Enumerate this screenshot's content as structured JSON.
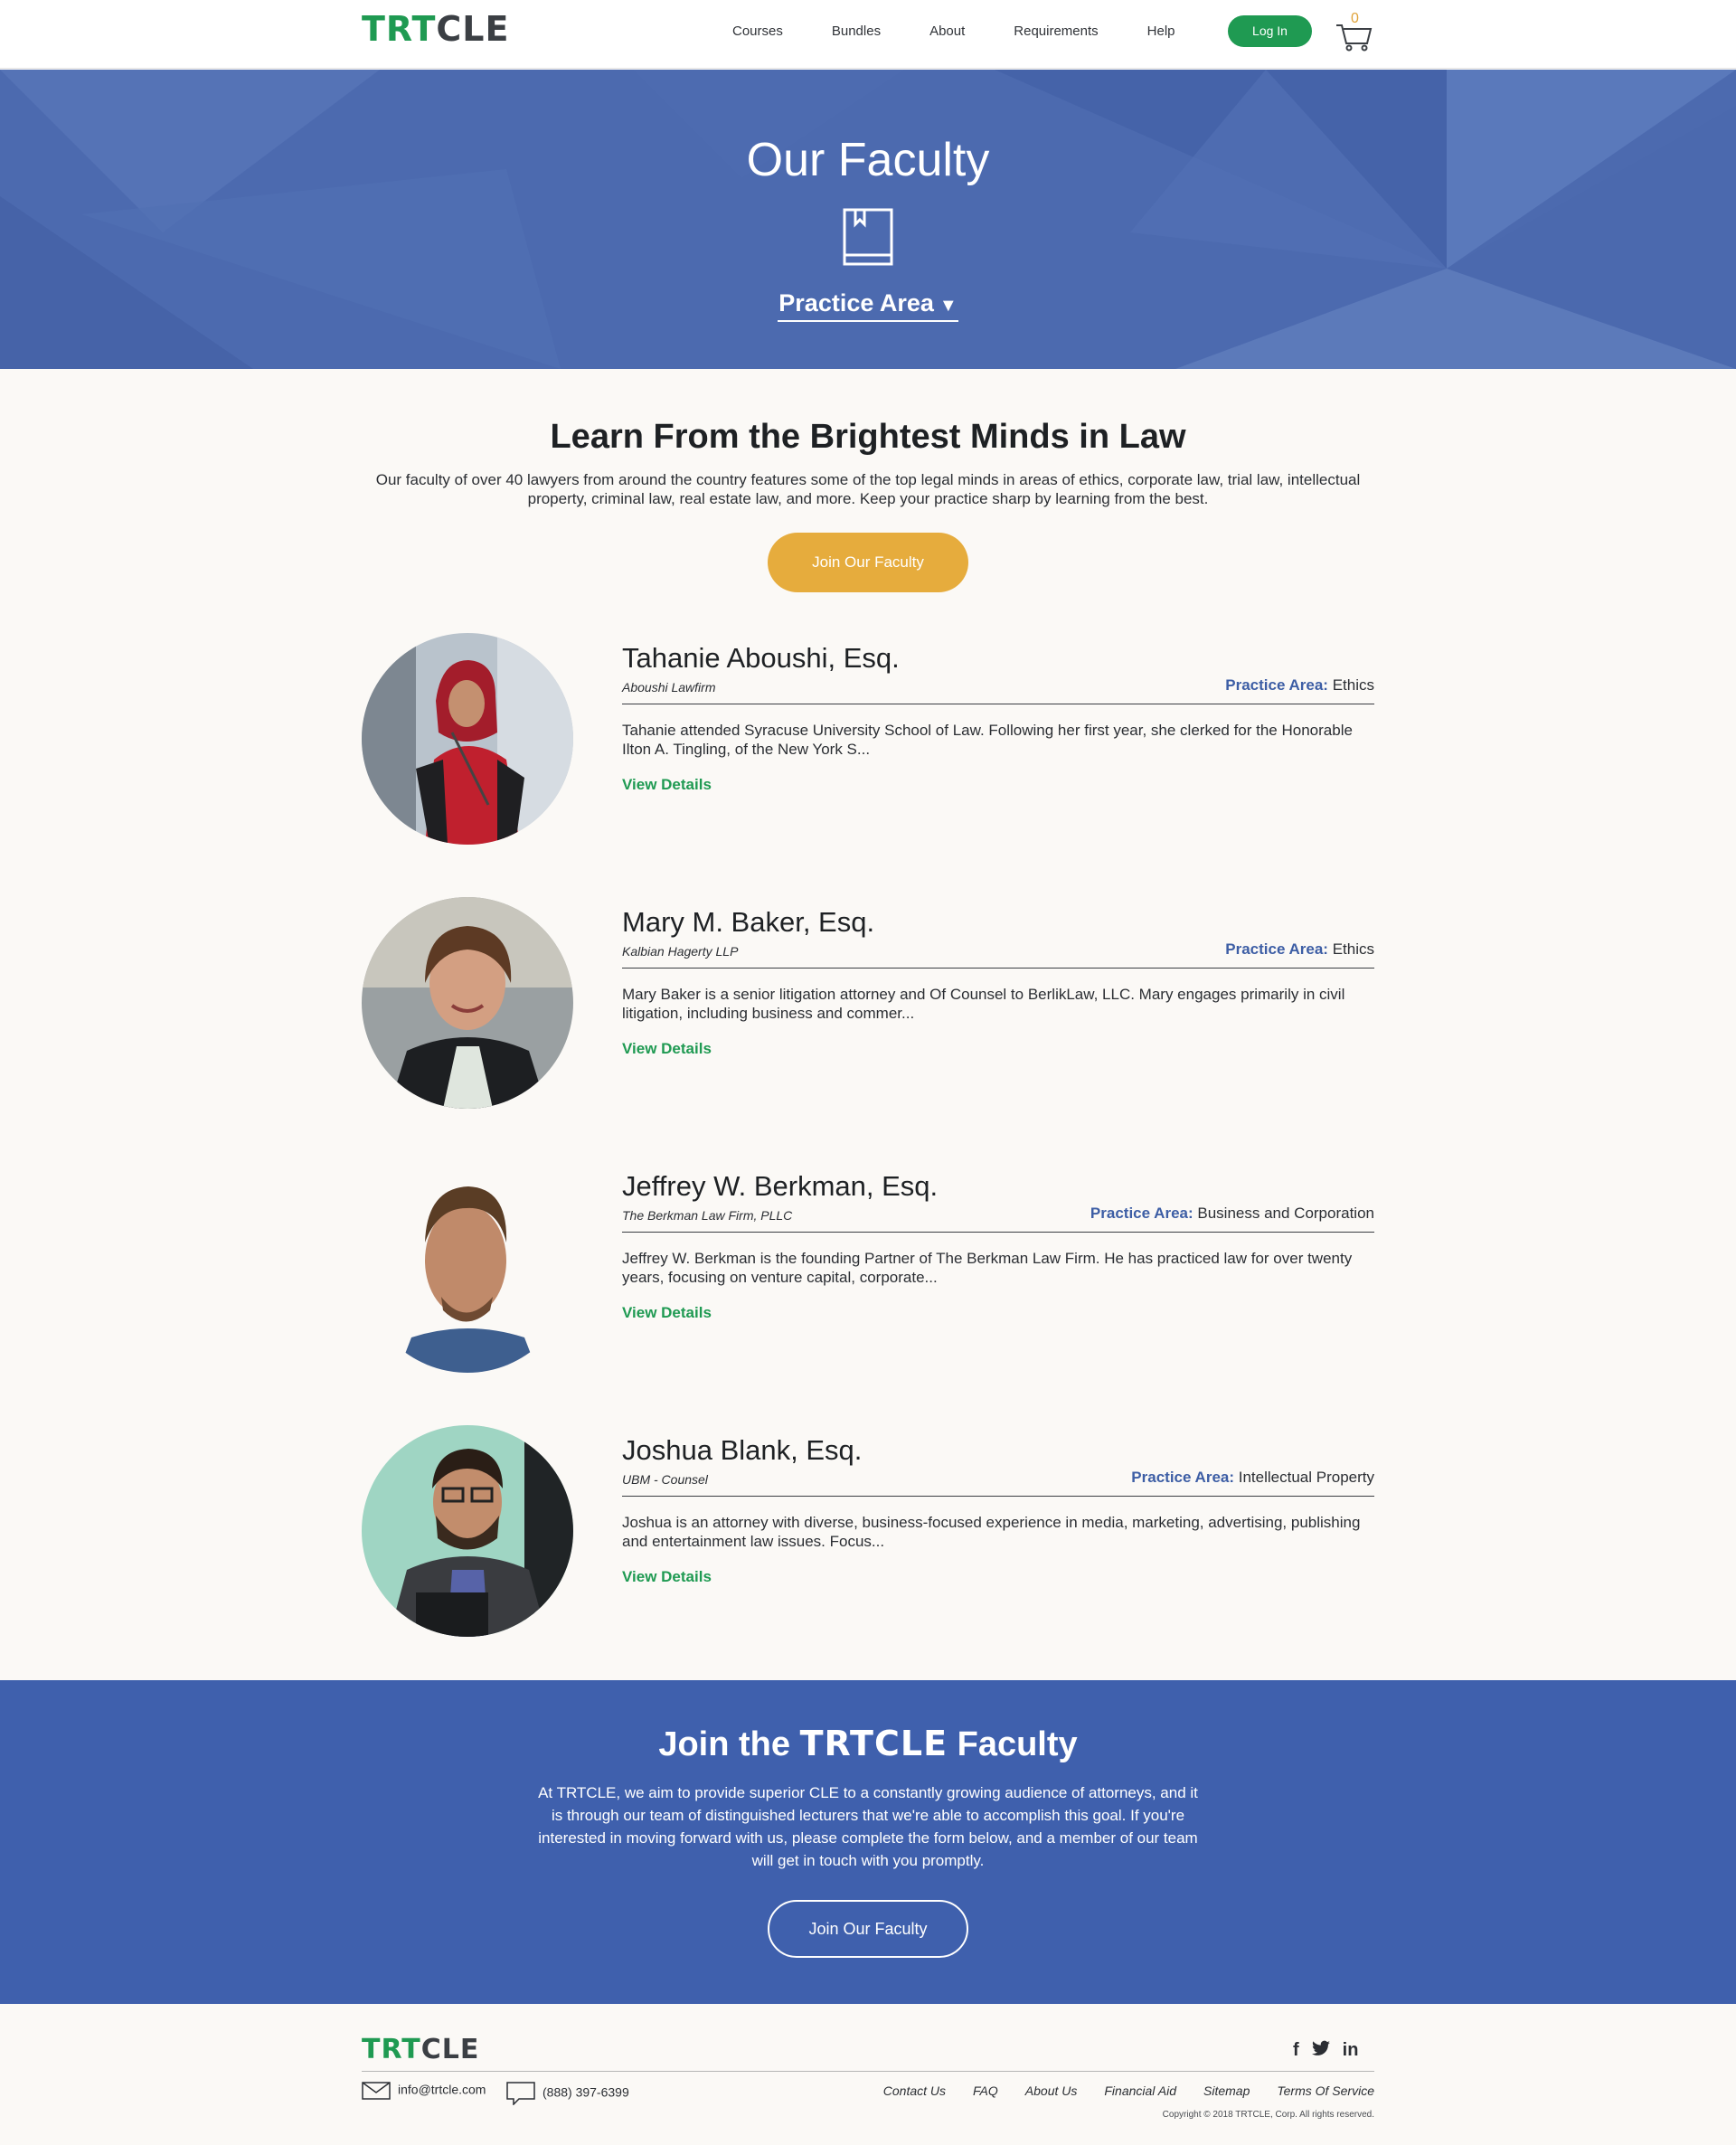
{
  "header": {
    "logo_green": "TRT",
    "logo_dark": "CLE",
    "nav": [
      "Courses",
      "Bundles",
      "About",
      "Requirements",
      "Help"
    ],
    "login": "Log In",
    "cart_count": "0"
  },
  "hero": {
    "title": "Our Faculty",
    "practice_select": "Practice Area"
  },
  "intro": {
    "title": "Learn From the Brightest Minds in Law",
    "text": "Our faculty of over 40 lawyers from around the country features some of the top legal minds in areas of ethics, corporate law, trial law, intellectual property, criminal law, real estate law, and more. Keep your practice sharp by learning from the best.",
    "join_button": "Join Our Faculty"
  },
  "faculty": [
    {
      "name": "Tahanie Aboushi, Esq.",
      "firm": "Aboushi Lawfirm",
      "area_label": "Practice Area:",
      "area": "Ethics",
      "bio": "Tahanie attended Syracuse University School of Law.  Following her first year, she clerked for the Honorable Ilton A. Tingling, of the New York S...",
      "link": "View Details"
    },
    {
      "name": "Mary M. Baker, Esq.",
      "firm": "Kalbian Hagerty LLP",
      "area_label": "Practice Area:",
      "area": "Ethics",
      "bio": "Mary Baker is a senior litigation attorney and Of Counsel to BerlikLaw, LLC. Mary engages primarily in civil litigation, including business and commer...",
      "link": "View Details"
    },
    {
      "name": "Jeffrey W. Berkman, Esq.",
      "firm": "The Berkman Law Firm, PLLC",
      "area_label": "Practice Area:",
      "area": "Business and Corporation",
      "bio": "Jeffrey W. Berkman is the founding Partner of The Berkman Law Firm. He has practiced law for over twenty years, focusing on venture capital, corporate...",
      "link": "View Details"
    },
    {
      "name": "Joshua Blank, Esq.",
      "firm": "UBM - Counsel",
      "area_label": "Practice Area:",
      "area": "Intellectual Property",
      "bio": "Joshua is an attorney with diverse, business-focused experience in media, marketing, advertising, publishing and entertainment law issues.  Focus...",
      "link": "View Details"
    }
  ],
  "join": {
    "title_prefix": "Join the",
    "title_brand": "TRTCLE",
    "title_suffix": "Faculty",
    "text": "At TRTCLE, we aim to provide superior CLE to a constantly growing audience of attorneys, and it is through our team of distinguished lecturers that we're able to accomplish this goal. If you're interested in moving forward with us, please complete the form below, and a member of our team will get in touch with you promptly.",
    "button": "Join Our Faculty"
  },
  "footer": {
    "logo_green": "TRT",
    "logo_dark": "CLE",
    "email": "info@trtcle.com",
    "phone": "(888) 397-6399",
    "links": [
      "Contact Us",
      "FAQ",
      "About Us",
      "Financial Aid",
      "Sitemap",
      "Terms Of Service"
    ],
    "copyright": "Copyright © 2018 TRTCLE, Corp. All rights reserved.",
    "social": [
      "facebook-icon",
      "twitter-icon",
      "linkedin-icon"
    ]
  },
  "colors": {
    "brand_green": "#1f9a52",
    "hero_blue": "#4c6aaf",
    "join_blue": "#3f60ad",
    "gold": "#e6ac3d",
    "area_label_blue": "#3d5ea5"
  }
}
